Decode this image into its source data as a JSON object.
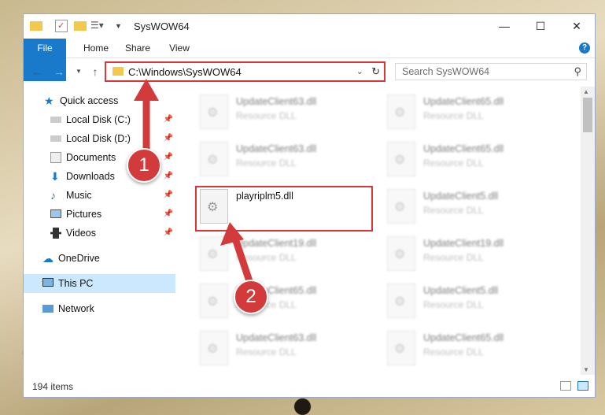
{
  "window": {
    "title": "SysWOW64",
    "controls": {
      "minimize": "—",
      "maximize": "☐",
      "close": "✕"
    }
  },
  "ribbon": {
    "tabs": [
      "File",
      "Home",
      "Share",
      "View"
    ],
    "help": "?"
  },
  "nav": {
    "address": "C:\\Windows\\SysWOW64",
    "search_placeholder": "Search SysWOW64"
  },
  "sidebar": {
    "items": [
      {
        "label": "Quick access"
      },
      {
        "label": "Local Disk (C:)"
      },
      {
        "label": "Local Disk (D:)"
      },
      {
        "label": "Documents"
      },
      {
        "label": "Downloads"
      },
      {
        "label": "Music"
      },
      {
        "label": "Pictures"
      },
      {
        "label": "Videos"
      },
      {
        "label": "OneDrive"
      },
      {
        "label": "This PC"
      },
      {
        "label": "Network"
      }
    ]
  },
  "files": [
    {
      "name": "UpdateClient63.dll",
      "type": "Resource DLL"
    },
    {
      "name": "UpdateClient65.dll",
      "type": "Resource DLL"
    },
    {
      "name": "UpdateClient63.dll",
      "type": "Resource DLL"
    },
    {
      "name": "UpdateClient65.dll",
      "type": "Resource DLL"
    },
    {
      "name": "playriplm5.dll",
      "type": ""
    },
    {
      "name": "UpdateClient5.dll",
      "type": "Resource DLL"
    },
    {
      "name": "UpdateClient19.dll",
      "type": "Resource DLL"
    },
    {
      "name": "UpdateClient19.dll",
      "type": "Resource DLL"
    },
    {
      "name": "UpdateClient65.dll",
      "type": "Resource DLL"
    },
    {
      "name": "UpdateClient5.dll",
      "type": "Resource DLL"
    },
    {
      "name": "UpdateClient63.dll",
      "type": "Resource DLL"
    },
    {
      "name": "UpdateClient65.dll",
      "type": "Resource DLL"
    }
  ],
  "status": {
    "count": "194 items"
  },
  "annotations": {
    "step1": "1",
    "step2": "2"
  },
  "colors": {
    "accent": "#1979ca",
    "highlight": "#d9373a",
    "selected": "#cce8ff"
  }
}
